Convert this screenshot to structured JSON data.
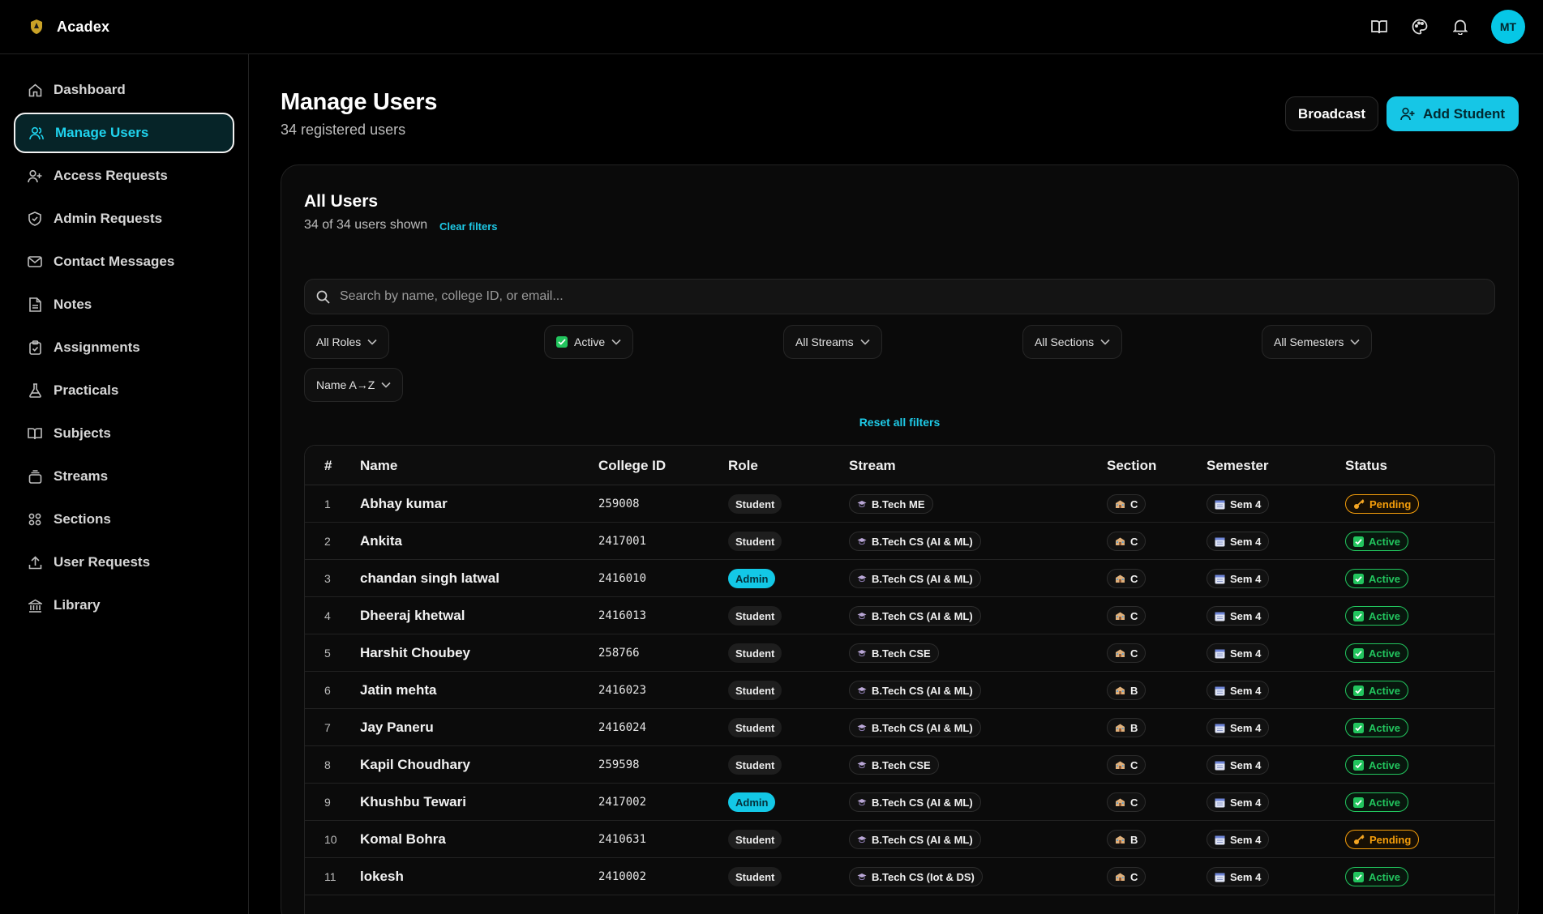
{
  "app": {
    "name": "Acadex",
    "avatar_initials": "MT"
  },
  "topbar": {
    "icons": [
      "book-icon",
      "palette-icon",
      "bell-icon"
    ]
  },
  "sidebar": {
    "items": [
      {
        "label": "Dashboard",
        "icon": "home-icon"
      },
      {
        "label": "Manage Users",
        "icon": "users-icon",
        "active": true
      },
      {
        "label": "Access Requests",
        "icon": "user-plus-icon"
      },
      {
        "label": "Admin Requests",
        "icon": "shield-icon"
      },
      {
        "label": "Contact Messages",
        "icon": "mail-icon"
      },
      {
        "label": "Notes",
        "icon": "file-icon"
      },
      {
        "label": "Assignments",
        "icon": "clipboard-icon"
      },
      {
        "label": "Practicals",
        "icon": "flask-icon"
      },
      {
        "label": "Subjects",
        "icon": "book-open-icon"
      },
      {
        "label": "Streams",
        "icon": "layers-icon"
      },
      {
        "label": "Sections",
        "icon": "grid-icon"
      },
      {
        "label": "User Requests",
        "icon": "upload-icon"
      },
      {
        "label": "Library",
        "icon": "library-icon"
      }
    ]
  },
  "header": {
    "title": "Manage Users",
    "subtitle": "34 registered users",
    "broadcast_label": "Broadcast",
    "add_label": "Add Student"
  },
  "card": {
    "title": "All Users",
    "count_text": "34 of 34 users shown",
    "clear_label": "Clear filters",
    "search_placeholder": "Search by name, college ID, or email...",
    "filters": {
      "role": "All Roles",
      "status": "Active",
      "stream": "All Streams",
      "section": "All Sections",
      "semester": "All Semesters",
      "sort": "Name A→Z"
    },
    "reset_label": "Reset all filters"
  },
  "table": {
    "headers": {
      "num": "#",
      "name": "Name",
      "college_id": "College ID",
      "role": "Role",
      "stream": "Stream",
      "section": "Section",
      "semester": "Semester",
      "status": "Status"
    },
    "rows": [
      {
        "num": "1",
        "name": "Abhay kumar",
        "id": "259008",
        "role": "Student",
        "stream": "B.Tech ME",
        "section": "C",
        "semester": "Sem 4",
        "status": "Pending"
      },
      {
        "num": "2",
        "name": "Ankita",
        "id": "2417001",
        "role": "Student",
        "stream": "B.Tech CS (AI & ML)",
        "section": "C",
        "semester": "Sem 4",
        "status": "Active"
      },
      {
        "num": "3",
        "name": "chandan singh latwal",
        "id": "2416010",
        "role": "Admin",
        "stream": "B.Tech CS (AI & ML)",
        "section": "C",
        "semester": "Sem 4",
        "status": "Active"
      },
      {
        "num": "4",
        "name": "Dheeraj khetwal",
        "id": "2416013",
        "role": "Student",
        "stream": "B.Tech CS (AI & ML)",
        "section": "C",
        "semester": "Sem 4",
        "status": "Active"
      },
      {
        "num": "5",
        "name": "Harshit Choubey",
        "id": "258766",
        "role": "Student",
        "stream": "B.Tech CSE",
        "section": "C",
        "semester": "Sem 4",
        "status": "Active"
      },
      {
        "num": "6",
        "name": "Jatin mehta",
        "id": "2416023",
        "role": "Student",
        "stream": "B.Tech CS (AI & ML)",
        "section": "B",
        "semester": "Sem 4",
        "status": "Active"
      },
      {
        "num": "7",
        "name": "Jay Paneru",
        "id": "2416024",
        "role": "Student",
        "stream": "B.Tech CS (AI & ML)",
        "section": "B",
        "semester": "Sem 4",
        "status": "Active"
      },
      {
        "num": "8",
        "name": "Kapil Choudhary",
        "id": "259598",
        "role": "Student",
        "stream": "B.Tech CSE",
        "section": "C",
        "semester": "Sem 4",
        "status": "Active"
      },
      {
        "num": "9",
        "name": "Khushbu Tewari",
        "id": "2417002",
        "role": "Admin",
        "stream": "B.Tech CS (AI & ML)",
        "section": "C",
        "semester": "Sem 4",
        "status": "Active"
      },
      {
        "num": "10",
        "name": "Komal Bohra",
        "id": "2410631",
        "role": "Student",
        "stream": "B.Tech CS (AI & ML)",
        "section": "B",
        "semester": "Sem 4",
        "status": "Pending"
      },
      {
        "num": "11",
        "name": "lokesh",
        "id": "2410002",
        "role": "Student",
        "stream": "B.Tech CS (Iot & DS)",
        "section": "C",
        "semester": "Sem 4",
        "status": "Active"
      }
    ]
  },
  "colors": {
    "accent": "#16c6e6",
    "active": "#22c55e",
    "pending": "#f59e0b",
    "background": "#000000"
  }
}
